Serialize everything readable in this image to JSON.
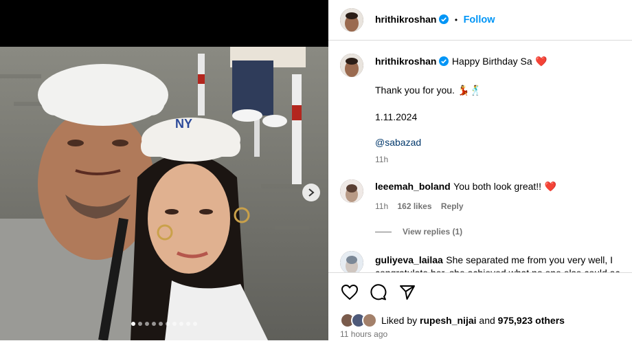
{
  "post": {
    "carousel": {
      "total_slides": 10,
      "active_slide": 1
    },
    "author": {
      "username": "hrithikroshan",
      "verified": true,
      "follow_label": "Follow",
      "separator": "•"
    },
    "caption": {
      "username": "hrithikroshan",
      "line1": "Happy Birthday Sa",
      "line1_emoji": "❤️",
      "line2": "Thank you for you.",
      "line2_emoji": "💃🕺",
      "line3": "1.11.2024",
      "mention": "@sabazad",
      "time": "11h"
    },
    "comments": [
      {
        "username": "leeemah_boland",
        "text": "You both look great!!",
        "emoji": "❤️",
        "time": "11h",
        "likes": "162 likes",
        "reply_label": "Reply",
        "view_replies": "View replies (1)"
      },
      {
        "username": "guliyeva_lailaa",
        "text": "She separated me from you very well, I congratulate her, she achieved what no one else could ac"
      }
    ],
    "likes": {
      "prefix": "Liked by",
      "user": "rupesh_nijai",
      "conjunction": "and",
      "count": "975,923 others"
    },
    "timestamp": "11 hours ago"
  },
  "colors": {
    "accent": "#0095f6",
    "heart": "#ff3040",
    "verified": "#0095f6",
    "muted": "#737373"
  }
}
